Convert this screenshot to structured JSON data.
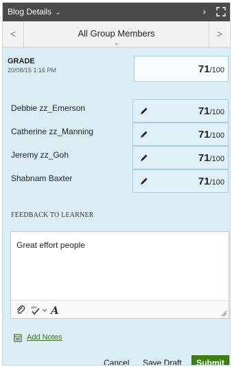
{
  "header": {
    "title": "Blog Details",
    "colors": {
      "bar": "#4a4a4a",
      "panel": "#dbeef6",
      "submit": "#3f7f12"
    }
  },
  "groupnav": {
    "label": "All Group Members",
    "prev_glyph": "<",
    "next_glyph": ">"
  },
  "grade": {
    "label": "GRADE",
    "date": "20/08/15 1:16 PM",
    "score": "71",
    "max": "/100"
  },
  "members": [
    {
      "name": "Debbie zz_Emerson",
      "score": "71",
      "max": "/100"
    },
    {
      "name": "Catherine zz_Manning",
      "score": "71",
      "max": "/100"
    },
    {
      "name": "Jeremy zz_Goh",
      "score": "71",
      "max": "/100"
    },
    {
      "name": "Shabnam Baxter",
      "score": "71",
      "max": "/100"
    }
  ],
  "feedback": {
    "label": "FEEDBACK TO LEARNER",
    "text": "Great effort people"
  },
  "notes": {
    "link": "Add Notes"
  },
  "footer": {
    "cancel": "Cancel",
    "save_draft": "Save Draft",
    "submit": "Submit"
  }
}
